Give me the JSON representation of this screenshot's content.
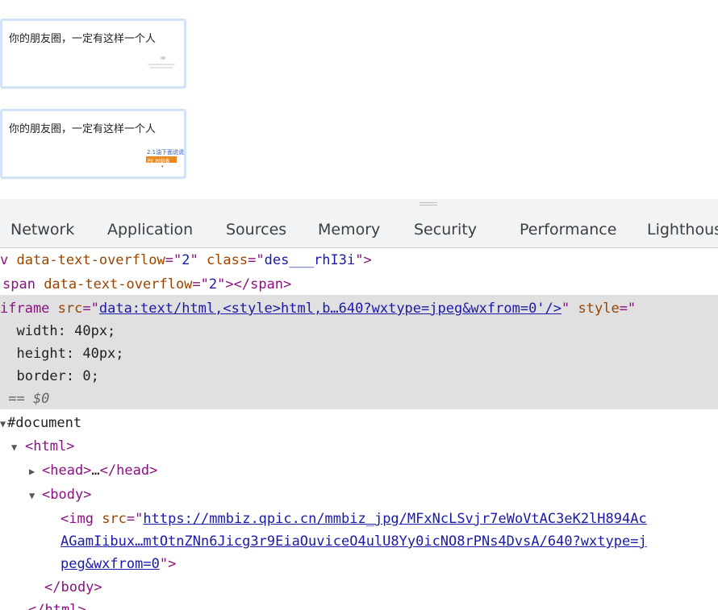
{
  "preview": {
    "cards": [
      {
        "title": "你的朋友圈，一定有这样一个人"
      },
      {
        "title": "你的朋友圈，一定有这样一个人"
      }
    ],
    "thumb_text_1": "2.1油下面说说",
    "thumb_text_2": "PE 时刻表"
  },
  "devtools": {
    "tabs": [
      "Network",
      "Application",
      "Sources",
      "Memory",
      "Security",
      "Performance",
      "Lighthous"
    ],
    "lines": {
      "l1": {
        "a": "v ",
        "b": "data-text-overflow",
        "c": "=\"",
        "d": "2",
        "e": "\" ",
        "f": "class",
        "g": "=\"",
        "h": "des___rhI3i",
        "i": "\">"
      },
      "l2": {
        "a": "span ",
        "b": "data-text-overflow",
        "c": "=\"",
        "d": "2",
        "e": "\"></span>"
      },
      "l3": {
        "a": "iframe ",
        "b": "src",
        "c": "=\"",
        "d": "data:text/html,<style>html,b…640?wxtype=jpeg&wxfrom=0'/>",
        "e": "\" ",
        "f": "style",
        "g": "=\""
      },
      "l4": "  width: 40px;",
      "l5": "  height: 40px;",
      "l6": "  border: 0;",
      "l7": " == $0",
      "l8": "#document",
      "l9": "<html>",
      "l10": {
        "a": "<head>",
        "b": "…",
        "c": "</head>"
      },
      "l11": "<body>",
      "l12": {
        "a": "<img ",
        "b": "src",
        "c": "=\"",
        "d": "https://mmbiz.qpic.cn/mmbiz_jpg/MFxNcLSvjr7eWoVtAC3eK2lH894Ac"
      },
      "l13": "AGamIibux…mtOtnZNn6Jicg3r9EiaOuviceO4ulU8Yy0icNO8rPNs4DvsA/640?wxtype=j",
      "l14": {
        "a": "peg&wxfrom=0",
        "b": "\">"
      },
      "l15": "</body>",
      "l16": "</html>"
    }
  }
}
